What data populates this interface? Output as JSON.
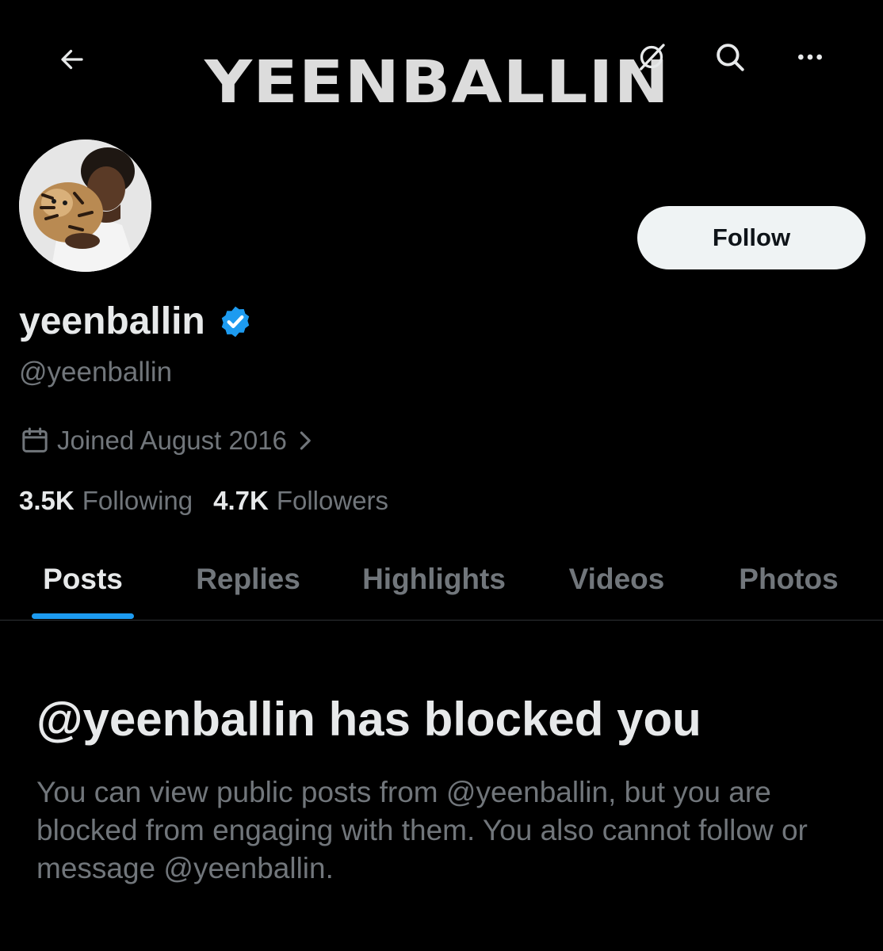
{
  "header": {
    "banner_text": "YEENBALLIN",
    "back_icon": "arrow-left-icon",
    "grok_icon": "grok-icon",
    "search_icon": "search-icon",
    "more_icon": "more-icon"
  },
  "profile": {
    "display_name": "yeenballin",
    "verified": true,
    "handle": "@yeenballin",
    "joined": "Joined August 2016",
    "follow_label": "Follow",
    "stats": {
      "following_count": "3.5K",
      "following_label": "Following",
      "followers_count": "4.7K",
      "followers_label": "Followers"
    }
  },
  "tabs": [
    {
      "label": "Posts",
      "active": true
    },
    {
      "label": "Replies",
      "active": false
    },
    {
      "label": "Highlights",
      "active": false
    },
    {
      "label": "Videos",
      "active": false
    },
    {
      "label": "Photos",
      "active": false
    }
  ],
  "blocked": {
    "title": "@yeenballin has blocked you",
    "body": "You can view public posts from @yeenballin, but you are blocked from engaging with them. You also cannot follow or message @yeenballin."
  },
  "colors": {
    "background": "#000000",
    "primary_text": "#e7e9ea",
    "secondary_text": "#71767b",
    "accent": "#1d9bf0",
    "follow_button_bg": "#eff3f4"
  }
}
